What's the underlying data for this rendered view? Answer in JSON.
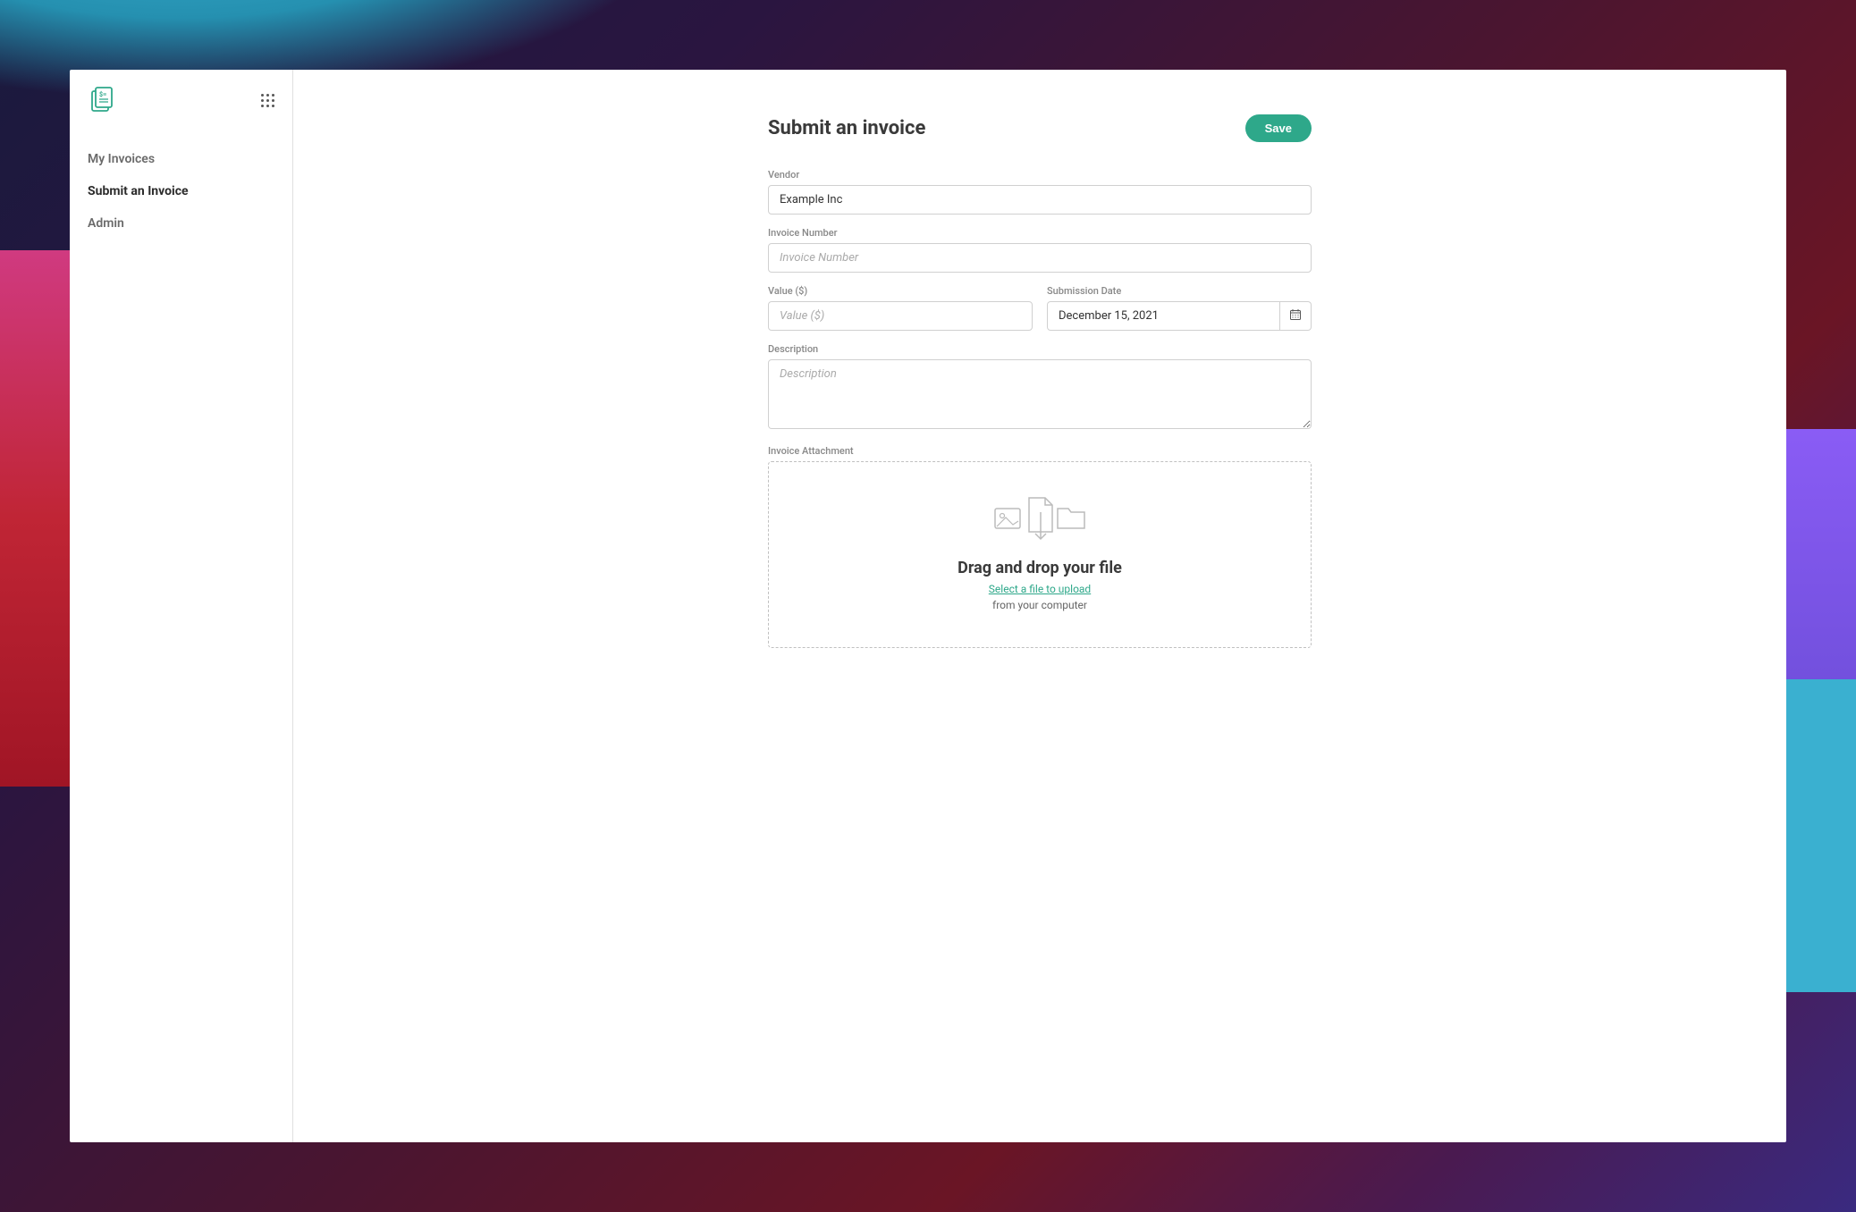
{
  "sidebar": {
    "items": [
      {
        "label": "My Invoices",
        "active": false
      },
      {
        "label": "Submit an Invoice",
        "active": true
      },
      {
        "label": "Admin",
        "active": false
      }
    ]
  },
  "page": {
    "title": "Submit an invoice",
    "save_label": "Save"
  },
  "form": {
    "vendor": {
      "label": "Vendor",
      "value": "Example Inc"
    },
    "invoice_number": {
      "label": "Invoice Number",
      "placeholder": "Invoice Number",
      "value": ""
    },
    "value": {
      "label": "Value ($)",
      "placeholder": "Value ($)",
      "value": ""
    },
    "submission_date": {
      "label": "Submission Date",
      "value": "December 15, 2021"
    },
    "description": {
      "label": "Description",
      "placeholder": "Description",
      "value": ""
    },
    "attachment": {
      "label": "Invoice Attachment",
      "dropzone_title": "Drag and drop your file",
      "dropzone_link": "Select a file to upload",
      "dropzone_subtext": "from your computer"
    }
  }
}
